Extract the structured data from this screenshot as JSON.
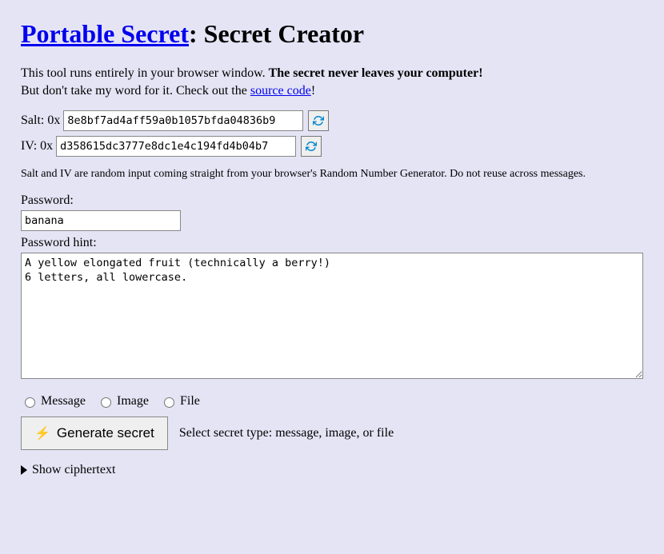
{
  "title": {
    "link_text": "Portable Secret",
    "suffix": ": Secret Creator"
  },
  "intro": {
    "line1_pre": "This tool runs entirely in your browser window. ",
    "line1_bold": "The secret never leaves your computer!",
    "line2_pre": "But don't take my word for it. Check out the ",
    "source_link": "source code",
    "line2_post": "!"
  },
  "salt": {
    "label": "Salt: 0x",
    "value": "8e8bf7ad4aff59a0b1057bfda04836b9"
  },
  "iv": {
    "label": "IV: 0x",
    "value": "d358615dc3777e8dc1e4c194fd4b04b7"
  },
  "rng_note": "Salt and IV are random input coming straight from your browser's Random Number Generator. Do not reuse across messages.",
  "password": {
    "label": "Password:",
    "value": "banana"
  },
  "hint": {
    "label": "Password hint:",
    "value": "A yellow elongated fruit (technically a berry!)\n6 letters, all lowercase."
  },
  "radios": {
    "message": "Message",
    "image": "Image",
    "file": "File"
  },
  "generate": {
    "button": "Generate secret",
    "status": "Select secret type: message, image, or file"
  },
  "details_summary": "Show ciphertext"
}
